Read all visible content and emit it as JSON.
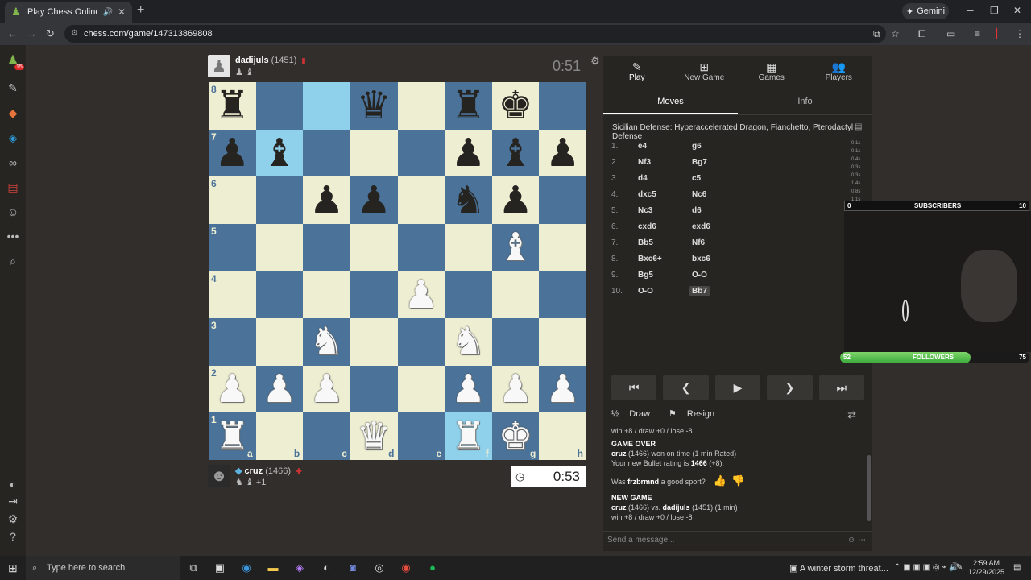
{
  "browser": {
    "tab_title": "Play Chess Online for FREE",
    "url": "chess.com/game/147313869808",
    "gemini_label": "Gemini"
  },
  "sidebar": {
    "badge": "15"
  },
  "top_player": {
    "name": "dadijuls",
    "rating": "(1451)",
    "clock": "0:51",
    "captures": "♟ ♝"
  },
  "bottom_player": {
    "name": "cruz",
    "rating": "(1466)",
    "clock": "0:53",
    "captures": "♞ ♝",
    "extra": "+1"
  },
  "board": {
    "rows": [
      [
        "r",
        "",
        "",
        "q",
        "",
        "r",
        "k",
        ""
      ],
      [
        "p",
        "b",
        "",
        "",
        "",
        "p",
        "b",
        "p"
      ],
      [
        "",
        "",
        "p",
        "p",
        "",
        "n",
        "p",
        ""
      ],
      [
        "",
        "",
        "",
        "",
        "",
        "",
        "B",
        ""
      ],
      [
        "",
        "",
        "",
        "",
        "P",
        "",
        "",
        ""
      ],
      [
        "",
        "",
        "N",
        "",
        "",
        "N",
        "",
        ""
      ],
      [
        "P",
        "P",
        "P",
        "",
        "",
        "P",
        "P",
        "P"
      ],
      [
        "R",
        "",
        "",
        "Q",
        "",
        "R",
        "K",
        ""
      ]
    ],
    "ranks": [
      "8",
      "7",
      "6",
      "5",
      "4",
      "3",
      "2",
      "1"
    ],
    "files": [
      "a",
      "b",
      "c",
      "d",
      "e",
      "f",
      "g",
      "h"
    ]
  },
  "panel": {
    "tabs": [
      {
        "label": "Play",
        "icon": "pawn-icon"
      },
      {
        "label": "New Game",
        "icon": "plus-icon"
      },
      {
        "label": "Games",
        "icon": "board-icon"
      },
      {
        "label": "Players",
        "icon": "people-icon"
      }
    ],
    "subtabs": [
      "Moves",
      "Info"
    ],
    "opening": "Sicilian Defense: Hyperaccelerated Dragon, Fianchetto, Pterodactyl Defense",
    "moves": [
      {
        "n": "1.",
        "w": "e4",
        "b": "g6"
      },
      {
        "n": "2.",
        "w": "Nf3",
        "b": "Bg7"
      },
      {
        "n": "3.",
        "w": "d4",
        "b": "c5"
      },
      {
        "n": "4.",
        "w": "dxc5",
        "b": "Nc6"
      },
      {
        "n": "5.",
        "w": "Nc3",
        "b": "d6"
      },
      {
        "n": "6.",
        "w": "cxd6",
        "b": "exd6"
      },
      {
        "n": "7.",
        "w": "Bb5",
        "b": "Nf6"
      },
      {
        "n": "8.",
        "w": "Bxc6+",
        "b": "bxc6"
      },
      {
        "n": "9.",
        "w": "Bg5",
        "b": "O-O"
      },
      {
        "n": "10.",
        "w": "O-O",
        "b": "Bb7"
      }
    ],
    "times": [
      "0.1s",
      "0.1s",
      "0.4s",
      "0.3s",
      "0.3s",
      "1.4s",
      "0.8s",
      "1.1s",
      "0.7s"
    ],
    "draw_label": "Draw",
    "resign_label": "Resign",
    "chat": {
      "line0": "win +8 / draw +0 / lose -8",
      "game_over": "GAME OVER",
      "result_name": "cruz",
      "result_text": " (1466) won on time (1 min Rated)",
      "rating_text": "Your new Bullet rating is ",
      "rating_val": "1466",
      "rating_delta": " (+8).",
      "sport_pre": "Was ",
      "sport_name": "frzbrmnd",
      "sport_post": " a good sport?",
      "new_game": "NEW GAME",
      "ng_p1": "cruz",
      "ng_mid": " (1466) vs. ",
      "ng_p2": "dadijuls",
      "ng_tail": " (1451) (1 min)",
      "line_end": "win +8 / draw +0 / lose -8"
    },
    "chat_placeholder": "Send a message..."
  },
  "overlay": {
    "subs_left": "0",
    "subs_label": "SUBSCRIBERS",
    "subs_right": "10",
    "follow_left": "52",
    "follow_label": "FOLLOWERS",
    "follow_right": "75",
    "follow_progress": 0.69
  },
  "taskbar": {
    "search": "Type here to search",
    "weather": "A winter storm threat...",
    "time": "2:59 AM",
    "date": "12/29/2025"
  }
}
